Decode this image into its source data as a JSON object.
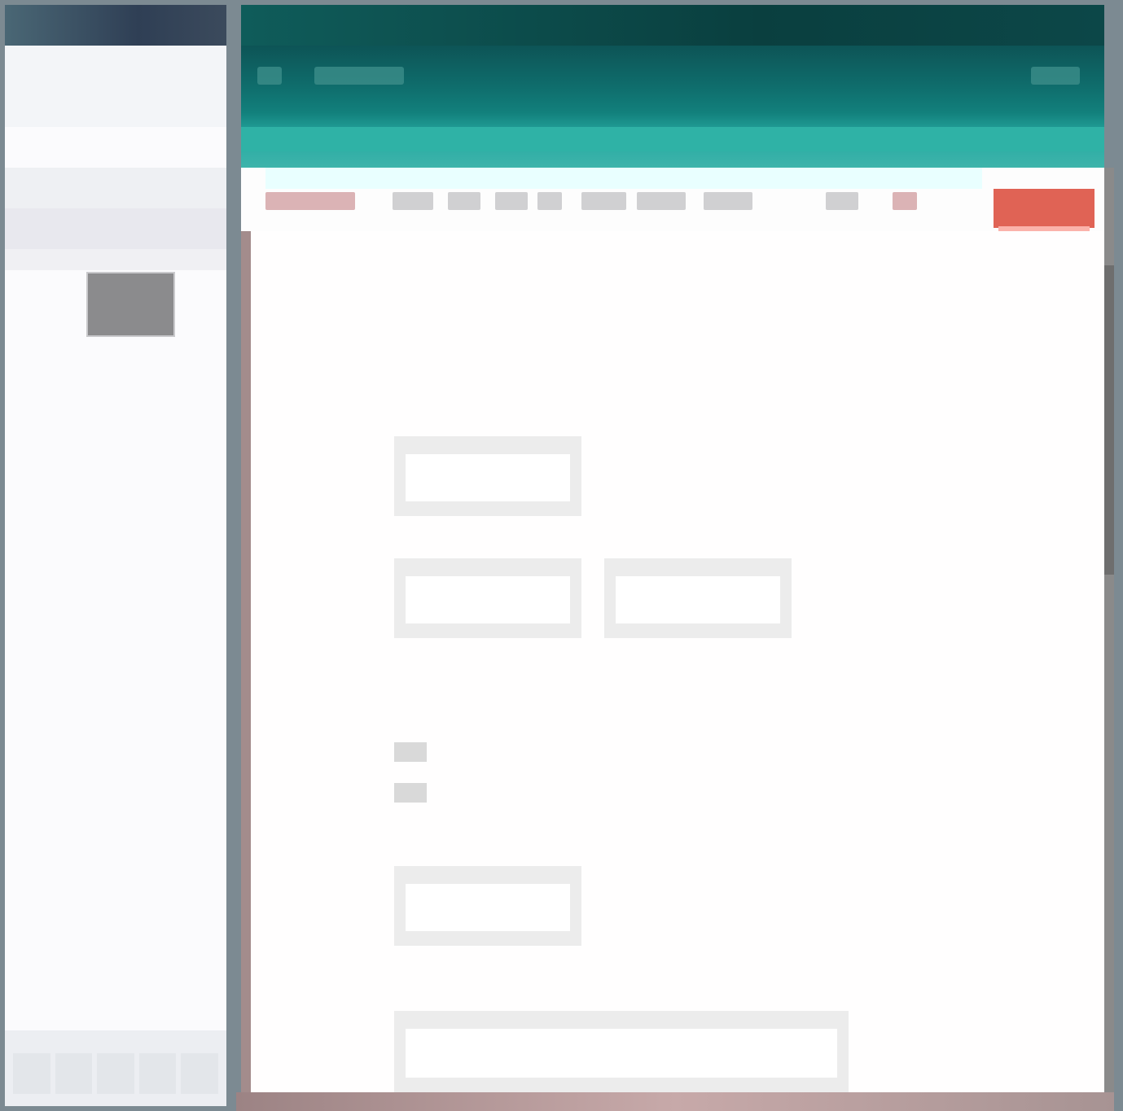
{
  "left_panel": {
    "title": "",
    "thumbnail_label": ""
  },
  "window": {
    "title": "",
    "close_label": ""
  },
  "toolbar": {
    "items": [
      "",
      "",
      "",
      "",
      "",
      "",
      "",
      "",
      ""
    ]
  },
  "form": {
    "heading": "",
    "fields": [
      {
        "label": "",
        "value": ""
      },
      {
        "label": "",
        "value": ""
      },
      {
        "label": "",
        "value": ""
      },
      {
        "label": "",
        "value": ""
      },
      {
        "label": "",
        "value": ""
      }
    ],
    "options_heading": "",
    "options": [
      "",
      ""
    ]
  },
  "colors": {
    "header_teal": "#0f6e6d",
    "close_red": "#e06355",
    "section_title": "#b69595"
  }
}
